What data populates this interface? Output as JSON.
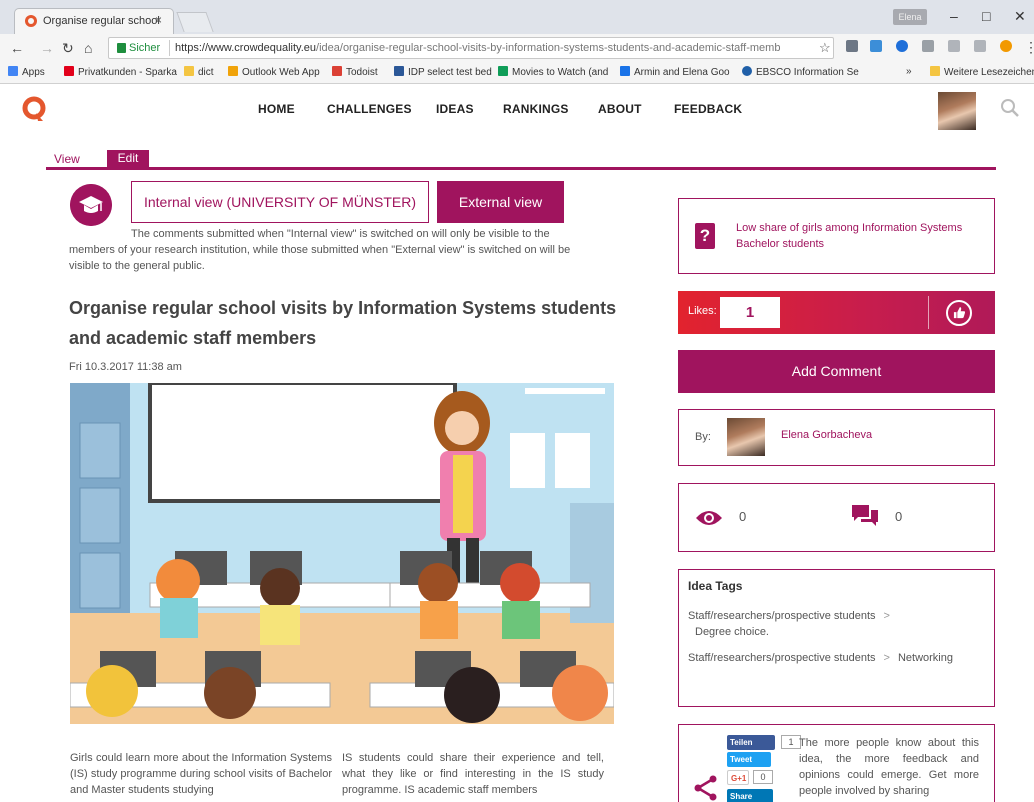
{
  "browser": {
    "tab_title": "Organise regular school",
    "tab_close": "×",
    "profile_name": "Elena",
    "window_buttons": [
      "–",
      "□",
      "✕"
    ],
    "secure_label": "Sicher",
    "url_host": "https://www.crowdequality.eu",
    "url_path": "/idea/organise-regular-school-visits-by-information-systems-students-and-academic-staff-memb",
    "bookmarks": [
      {
        "label": "Apps",
        "color": "#4285f4"
      },
      {
        "label": "Privatkunden - Sparka",
        "color": "#e2001a"
      },
      {
        "label": "dict",
        "color": "#f4c542"
      },
      {
        "label": "Outlook Web App",
        "color": "#f0a30a"
      },
      {
        "label": "Todoist",
        "color": "#db4035"
      },
      {
        "label": "IDP select test bed",
        "color": "#2b5797"
      },
      {
        "label": "Movies to Watch (and",
        "color": "#0f9d58"
      },
      {
        "label": "Armin and Elena Goo",
        "color": "#1a73e8"
      },
      {
        "label": "EBSCO Information Se",
        "color": "#1f5fa8"
      },
      {
        "label": "»",
        "color": ""
      },
      {
        "label": "Weitere Lesezeichen",
        "color": "#f4c542"
      }
    ]
  },
  "nav": {
    "items": [
      "HOME",
      "CHALLENGES",
      "IDEAS",
      "RANKINGS",
      "ABOUT",
      "FEEDBACK"
    ]
  },
  "tabs": {
    "view": "View",
    "edit": "Edit"
  },
  "view_toggle": {
    "internal": "Internal view (UNIVERSITY OF MÜNSTER)",
    "external": "External view",
    "note_line1": "The comments submitted when \"Internal view\" is switched on will only be visible to the",
    "note_line2": "members of your research institution, while those submitted when \"External view\" is switched on will be",
    "note_line3": "visible to the general public."
  },
  "idea": {
    "title": "Organise regular school visits by Information Systems students and academic staff members",
    "date": "Fri 10.3.2017 11:38 am",
    "body_col1": "Girls could learn more about the Information Systems (IS) study programme during school visits of Bachelor and Master students studying",
    "body_col2": "IS students could share their experience and tell, what they like or find interesting in the IS study programme. IS academic staff members"
  },
  "sidebar": {
    "challenge": "Low share of girls among Information Systems Bachelor students",
    "likes_label": "Likes:",
    "likes_count": "1",
    "add_comment": "Add Comment",
    "by_label": "By:",
    "author": "Elena Gorbacheva",
    "views": "0",
    "comments": "0",
    "tags_title": "Idea Tags",
    "tags": [
      {
        "parent": "Staff/researchers/prospective students",
        "child": "Degree choice."
      },
      {
        "parent": "Staff/researchers/prospective students",
        "child": "Networking"
      }
    ],
    "tag_separator": ">",
    "share": {
      "facebook": "Teilen",
      "facebook_count": "1",
      "twitter": "Tweet",
      "gplus": "G+1",
      "gplus_count": "0",
      "linkedin": "Share",
      "text": "The more people know about this idea, the more feedback and opinions could emerge. Get more people involved by sharing"
    }
  },
  "colors": {
    "brand": "#a0145e",
    "likes_gradient_start": "#e2232e"
  }
}
